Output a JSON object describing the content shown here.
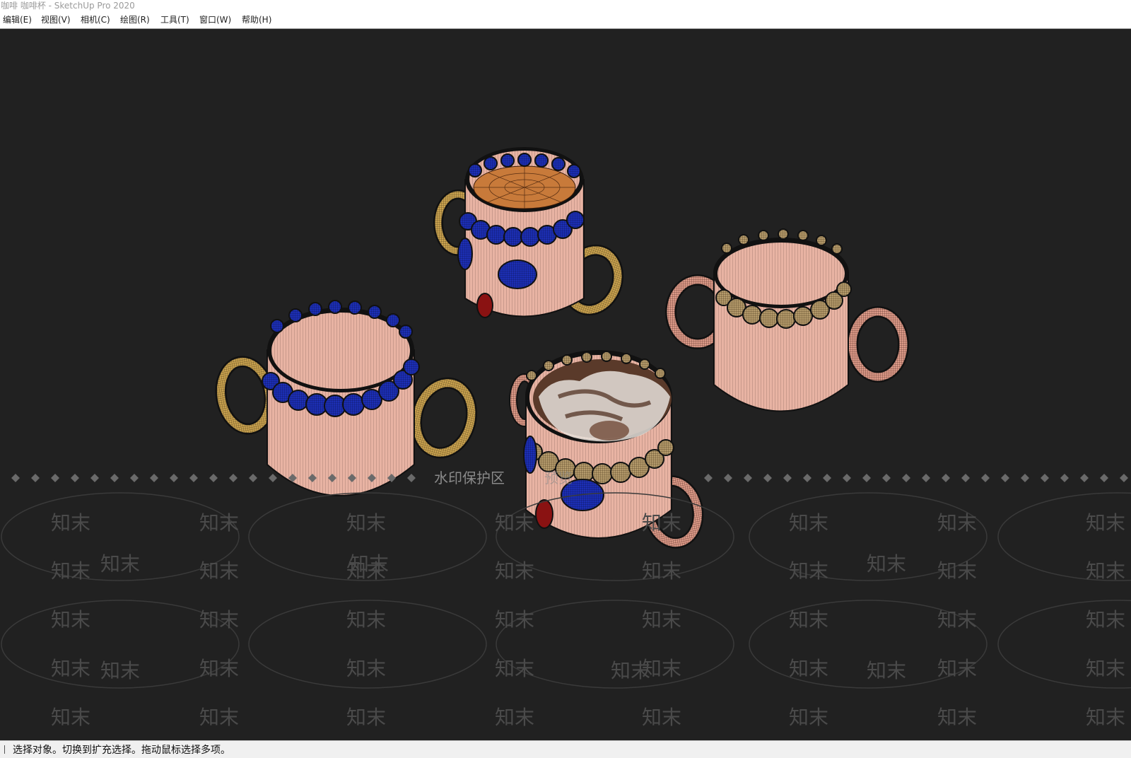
{
  "window": {
    "title": "咖啡 咖啡杯 - SketchUp Pro 2020"
  },
  "menu": {
    "items": [
      {
        "label": "编辑(E)"
      },
      {
        "label": "视图(V)"
      },
      {
        "label": "相机(C)"
      },
      {
        "label": "绘图(R)"
      },
      {
        "label": "工具(T)"
      },
      {
        "label": "窗口(W)"
      },
      {
        "label": "帮助(H)"
      }
    ]
  },
  "viewport": {
    "background_color": "#212121",
    "model_description": "four coffee mugs rendered with wireframe edges",
    "watermark": {
      "banner_text": "水印保护区",
      "banner_partial": "预览",
      "tile_text": "知末"
    }
  },
  "colors": {
    "mug_body": "#e8b3a3",
    "blue_trim": "#1c2fb5",
    "gold_trim": "#c9a24f",
    "tan_trim": "#b49a6b",
    "red_gem": "#8a1212",
    "coffee": "#c87a3a",
    "pink_handle": "#dc9a88"
  },
  "status": {
    "text": "选择对象。切换到扩充选择。拖动鼠标选择多项。"
  }
}
